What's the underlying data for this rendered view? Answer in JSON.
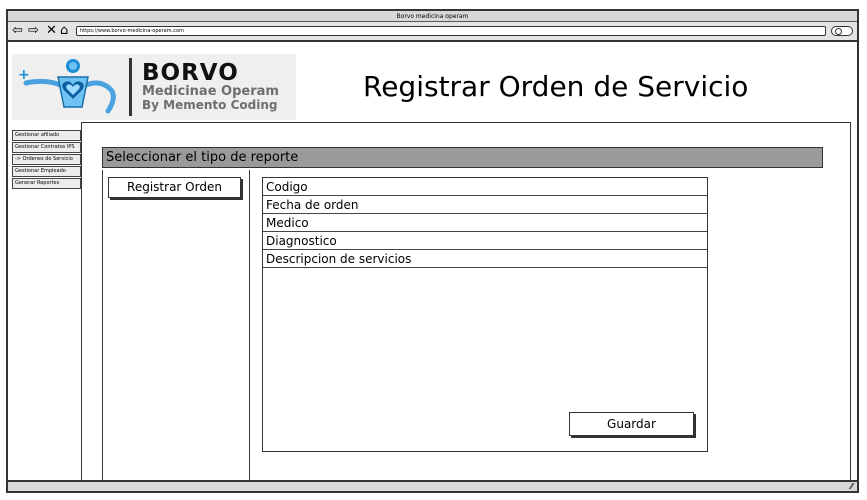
{
  "browser": {
    "window_title": "Borvo medicina operam",
    "url": "https://www.borvo-medicina-operam.com"
  },
  "header": {
    "logo_title": "BORVO",
    "logo_subtitle": "Medicinae Operam",
    "logo_tagline": "By Memento Coding",
    "page_title": "Registrar Orden de Servicio"
  },
  "sidebar": {
    "items": [
      {
        "label": "Gestionar afiliado"
      },
      {
        "label": "Gestionar Contratos IPS"
      },
      {
        "label": "-> Ordenes de Servicio"
      },
      {
        "label": "Gestionar Empleado"
      },
      {
        "label": "Generar Reportes"
      }
    ]
  },
  "main": {
    "section_label": "Seleccionar el tipo de reporte",
    "register_button": "Registrar Orden",
    "fields": [
      {
        "label": "Codigo"
      },
      {
        "label": "Fecha de orden"
      },
      {
        "label": "Medico"
      },
      {
        "label": "Diagnostico"
      },
      {
        "label": "Descripcion de servicios"
      }
    ],
    "save_button": "Guardar"
  },
  "colors": {
    "section_bar": "#9a9a9a",
    "logo_bg": "#efefef",
    "logo_blue": "#1a8fd6",
    "chrome": "#d8d8d8"
  }
}
